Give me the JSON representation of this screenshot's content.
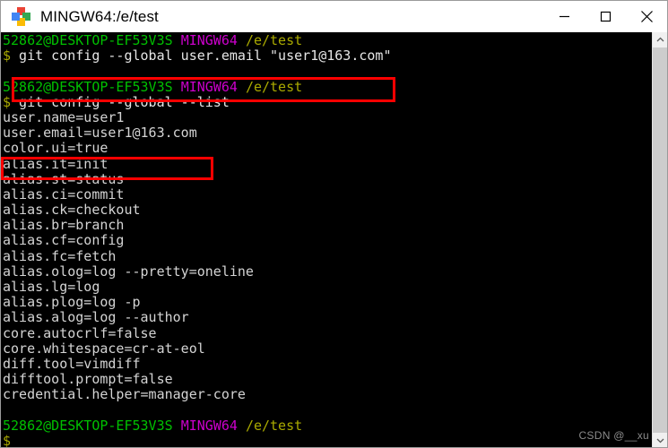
{
  "window": {
    "title": "MINGW64:/e/test",
    "icon": "mintty-diamond-icon",
    "controls": {
      "minimize": "minimize",
      "maximize": "maximize",
      "close": "close"
    }
  },
  "terminal": {
    "prompt": {
      "user_host": "52862@DESKTOP-EF53V3S",
      "shell": "MINGW64",
      "path": "/e/test",
      "symbol": "$"
    },
    "colors": {
      "background": "#000000",
      "user_host": "#00c000",
      "shell": "#cc00cc",
      "path": "#aaaa00",
      "output": "#d4d4d4",
      "annotation": "#ff0000"
    },
    "lines": [
      {
        "type": "prompt"
      },
      {
        "type": "command",
        "text": "git config --global user.email \"user1@163.com\""
      },
      {
        "type": "blank"
      },
      {
        "type": "prompt"
      },
      {
        "type": "command",
        "text": "git config --global --list"
      },
      {
        "type": "output",
        "text": "user.name=user1"
      },
      {
        "type": "output",
        "text": "user.email=user1@163.com"
      },
      {
        "type": "output",
        "text": "color.ui=true"
      },
      {
        "type": "output",
        "text": "alias.it=init"
      },
      {
        "type": "output",
        "text": "alias.st=status"
      },
      {
        "type": "output",
        "text": "alias.ci=commit"
      },
      {
        "type": "output",
        "text": "alias.ck=checkout"
      },
      {
        "type": "output",
        "text": "alias.br=branch"
      },
      {
        "type": "output",
        "text": "alias.cf=config"
      },
      {
        "type": "output",
        "text": "alias.fc=fetch"
      },
      {
        "type": "output",
        "text": "alias.olog=log --pretty=oneline"
      },
      {
        "type": "output",
        "text": "alias.lg=log"
      },
      {
        "type": "output",
        "text": "alias.plog=log -p"
      },
      {
        "type": "output",
        "text": "alias.alog=log --author"
      },
      {
        "type": "output",
        "text": "core.autocrlf=false"
      },
      {
        "type": "output",
        "text": "core.whitespace=cr-at-eol"
      },
      {
        "type": "output",
        "text": "diff.tool=vimdiff"
      },
      {
        "type": "output",
        "text": "difftool.prompt=false"
      },
      {
        "type": "output",
        "text": "credential.helper=manager-core"
      },
      {
        "type": "blank"
      },
      {
        "type": "prompt"
      },
      {
        "type": "cursor"
      }
    ]
  },
  "annotations": [
    {
      "id": "annot-1",
      "target": "git config --global user.email \"user1@163.com\""
    },
    {
      "id": "annot-2",
      "target": "user.email=user1@163.com"
    }
  ],
  "watermark": {
    "text": "CSDN @__xu"
  },
  "scrollbar": {
    "up_arrow": "scroll-up",
    "down_arrow": "scroll-down"
  }
}
